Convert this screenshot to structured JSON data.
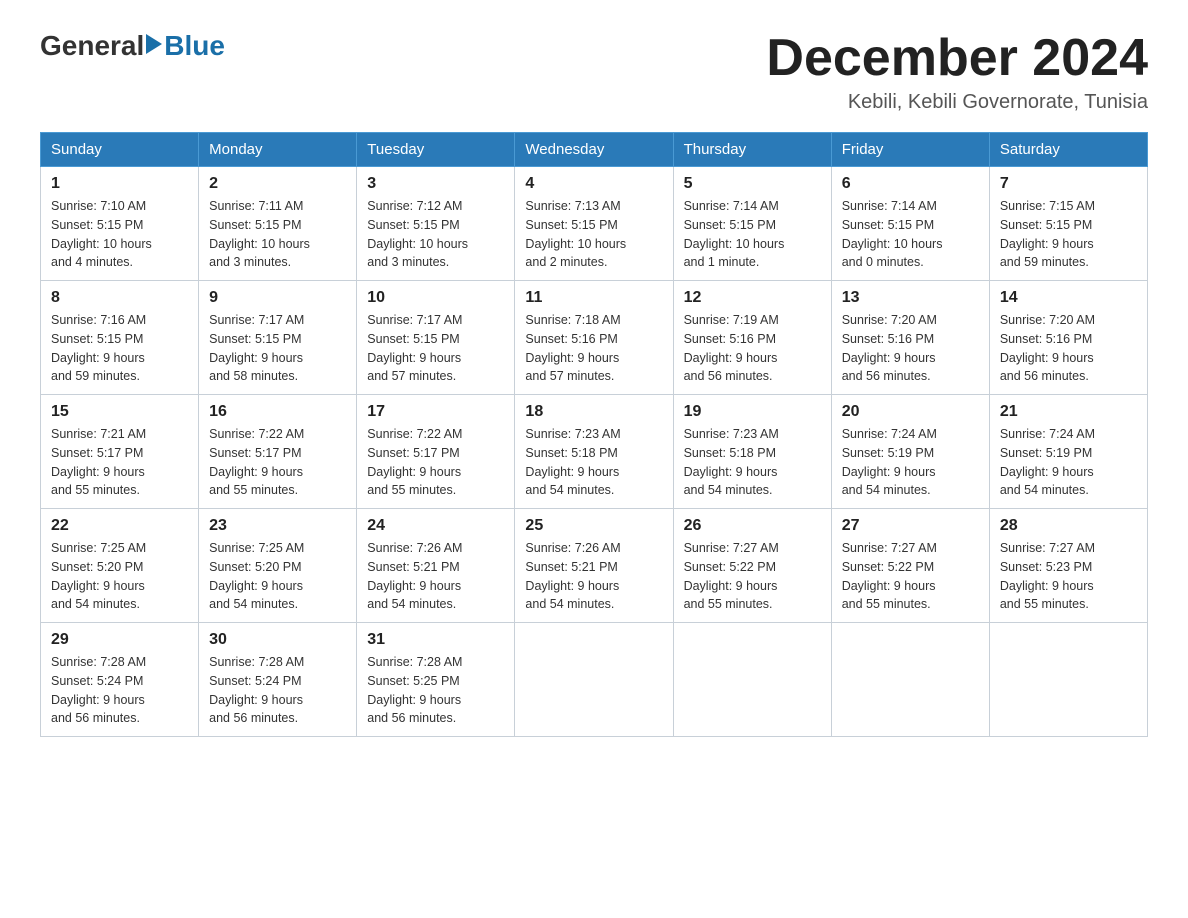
{
  "header": {
    "logo_general": "General",
    "logo_blue": "Blue",
    "main_title": "December 2024",
    "subtitle": "Kebili, Kebili Governorate, Tunisia"
  },
  "calendar": {
    "days_of_week": [
      "Sunday",
      "Monday",
      "Tuesday",
      "Wednesday",
      "Thursday",
      "Friday",
      "Saturday"
    ],
    "weeks": [
      [
        {
          "day": "1",
          "sunrise": "7:10 AM",
          "sunset": "5:15 PM",
          "daylight": "10 hours and 4 minutes."
        },
        {
          "day": "2",
          "sunrise": "7:11 AM",
          "sunset": "5:15 PM",
          "daylight": "10 hours and 3 minutes."
        },
        {
          "day": "3",
          "sunrise": "7:12 AM",
          "sunset": "5:15 PM",
          "daylight": "10 hours and 3 minutes."
        },
        {
          "day": "4",
          "sunrise": "7:13 AM",
          "sunset": "5:15 PM",
          "daylight": "10 hours and 2 minutes."
        },
        {
          "day": "5",
          "sunrise": "7:14 AM",
          "sunset": "5:15 PM",
          "daylight": "10 hours and 1 minute."
        },
        {
          "day": "6",
          "sunrise": "7:14 AM",
          "sunset": "5:15 PM",
          "daylight": "10 hours and 0 minutes."
        },
        {
          "day": "7",
          "sunrise": "7:15 AM",
          "sunset": "5:15 PM",
          "daylight": "9 hours and 59 minutes."
        }
      ],
      [
        {
          "day": "8",
          "sunrise": "7:16 AM",
          "sunset": "5:15 PM",
          "daylight": "9 hours and 59 minutes."
        },
        {
          "day": "9",
          "sunrise": "7:17 AM",
          "sunset": "5:15 PM",
          "daylight": "9 hours and 58 minutes."
        },
        {
          "day": "10",
          "sunrise": "7:17 AM",
          "sunset": "5:15 PM",
          "daylight": "9 hours and 57 minutes."
        },
        {
          "day": "11",
          "sunrise": "7:18 AM",
          "sunset": "5:16 PM",
          "daylight": "9 hours and 57 minutes."
        },
        {
          "day": "12",
          "sunrise": "7:19 AM",
          "sunset": "5:16 PM",
          "daylight": "9 hours and 56 minutes."
        },
        {
          "day": "13",
          "sunrise": "7:20 AM",
          "sunset": "5:16 PM",
          "daylight": "9 hours and 56 minutes."
        },
        {
          "day": "14",
          "sunrise": "7:20 AM",
          "sunset": "5:16 PM",
          "daylight": "9 hours and 56 minutes."
        }
      ],
      [
        {
          "day": "15",
          "sunrise": "7:21 AM",
          "sunset": "5:17 PM",
          "daylight": "9 hours and 55 minutes."
        },
        {
          "day": "16",
          "sunrise": "7:22 AM",
          "sunset": "5:17 PM",
          "daylight": "9 hours and 55 minutes."
        },
        {
          "day": "17",
          "sunrise": "7:22 AM",
          "sunset": "5:17 PM",
          "daylight": "9 hours and 55 minutes."
        },
        {
          "day": "18",
          "sunrise": "7:23 AM",
          "sunset": "5:18 PM",
          "daylight": "9 hours and 54 minutes."
        },
        {
          "day": "19",
          "sunrise": "7:23 AM",
          "sunset": "5:18 PM",
          "daylight": "9 hours and 54 minutes."
        },
        {
          "day": "20",
          "sunrise": "7:24 AM",
          "sunset": "5:19 PM",
          "daylight": "9 hours and 54 minutes."
        },
        {
          "day": "21",
          "sunrise": "7:24 AM",
          "sunset": "5:19 PM",
          "daylight": "9 hours and 54 minutes."
        }
      ],
      [
        {
          "day": "22",
          "sunrise": "7:25 AM",
          "sunset": "5:20 PM",
          "daylight": "9 hours and 54 minutes."
        },
        {
          "day": "23",
          "sunrise": "7:25 AM",
          "sunset": "5:20 PM",
          "daylight": "9 hours and 54 minutes."
        },
        {
          "day": "24",
          "sunrise": "7:26 AM",
          "sunset": "5:21 PM",
          "daylight": "9 hours and 54 minutes."
        },
        {
          "day": "25",
          "sunrise": "7:26 AM",
          "sunset": "5:21 PM",
          "daylight": "9 hours and 54 minutes."
        },
        {
          "day": "26",
          "sunrise": "7:27 AM",
          "sunset": "5:22 PM",
          "daylight": "9 hours and 55 minutes."
        },
        {
          "day": "27",
          "sunrise": "7:27 AM",
          "sunset": "5:22 PM",
          "daylight": "9 hours and 55 minutes."
        },
        {
          "day": "28",
          "sunrise": "7:27 AM",
          "sunset": "5:23 PM",
          "daylight": "9 hours and 55 minutes."
        }
      ],
      [
        {
          "day": "29",
          "sunrise": "7:28 AM",
          "sunset": "5:24 PM",
          "daylight": "9 hours and 56 minutes."
        },
        {
          "day": "30",
          "sunrise": "7:28 AM",
          "sunset": "5:24 PM",
          "daylight": "9 hours and 56 minutes."
        },
        {
          "day": "31",
          "sunrise": "7:28 AM",
          "sunset": "5:25 PM",
          "daylight": "9 hours and 56 minutes."
        },
        null,
        null,
        null,
        null
      ]
    ],
    "labels": {
      "sunrise": "Sunrise:",
      "sunset": "Sunset:",
      "daylight": "Daylight:"
    }
  }
}
